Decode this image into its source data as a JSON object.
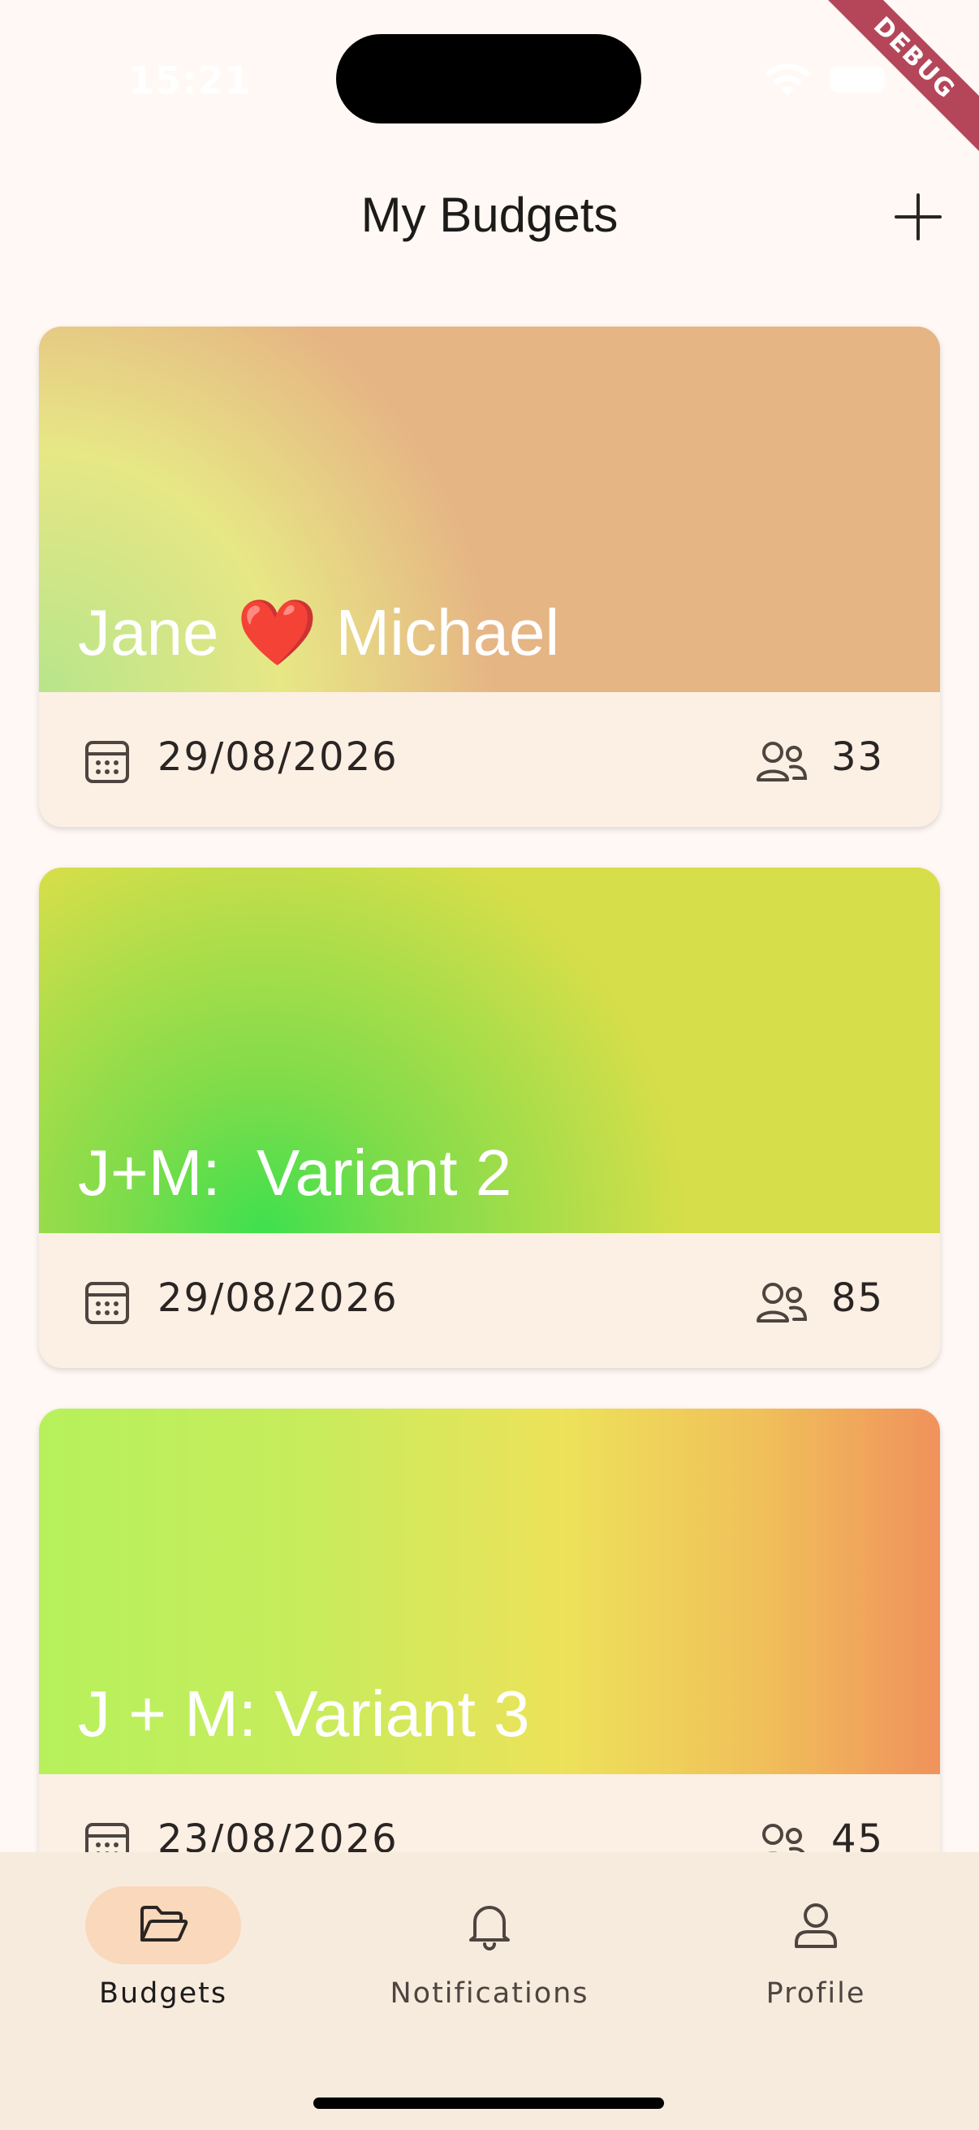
{
  "status_bar": {
    "time": "15:21",
    "wifi_icon": "wifi-icon",
    "battery_icon": "battery-icon"
  },
  "debug_banner": "DEBUG",
  "header": {
    "title": "My Budgets",
    "add_icon": "plus-icon"
  },
  "budgets": [
    {
      "title": "Jane ❤️ Michael",
      "date": "29/08/2026",
      "count": "33",
      "date_icon": "calendar-icon",
      "count_icon": "people-icon"
    },
    {
      "title": "J+M:  Variant 2",
      "date": "29/08/2026",
      "count": "85",
      "date_icon": "calendar-icon",
      "count_icon": "people-icon"
    },
    {
      "title": "J + M: Variant 3",
      "date": "23/08/2026",
      "count": "45",
      "date_icon": "calendar-icon",
      "count_icon": "people-icon"
    }
  ],
  "bottom_nav": {
    "items": [
      {
        "label": "Budgets",
        "icon": "folder-open-icon",
        "active": true
      },
      {
        "label": "Notifications",
        "icon": "bell-icon",
        "active": false
      },
      {
        "label": "Profile",
        "icon": "person-icon",
        "active": false
      }
    ]
  },
  "colors": {
    "background": "#fff8f4",
    "card_footer": "#fcf0e4",
    "nav_background": "#f7ebde",
    "nav_active_pill": "#fad8bb",
    "debug_ribbon": "#b5465a"
  }
}
